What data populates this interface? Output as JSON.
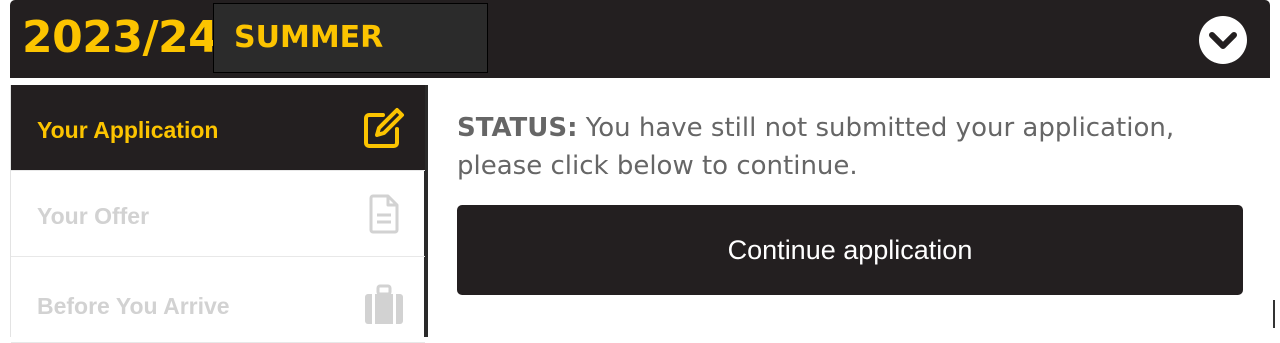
{
  "header": {
    "year": "2023/24",
    "term": "SUMMER",
    "toggle_icon": "chevron-down-icon"
  },
  "colors": {
    "brand_dark": "#231f20",
    "accent_yellow": "#fcc400",
    "inactive_text": "#d2d2d2",
    "status_text": "#666666"
  },
  "sidebar": {
    "items": [
      {
        "label": "Your Application",
        "icon": "edit-icon",
        "active": true
      },
      {
        "label": "Your Offer",
        "icon": "document-icon",
        "active": false
      },
      {
        "label": "Before You Arrive",
        "icon": "luggage-icon",
        "active": false
      }
    ]
  },
  "main": {
    "status_label": "STATUS:",
    "status_text": " You have still not submitted your application, please click below to continue.",
    "continue_label": "Continue application"
  }
}
